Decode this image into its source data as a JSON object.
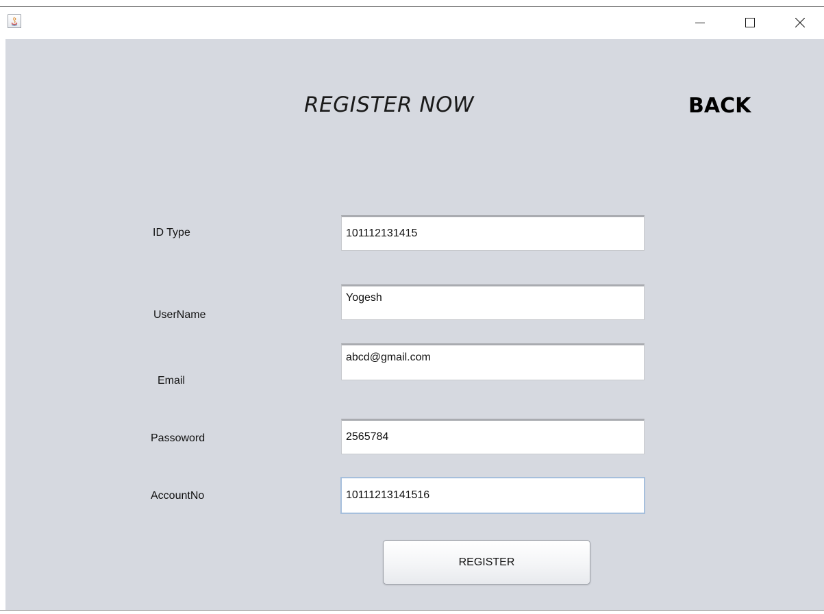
{
  "window": {
    "icon": "java-app-icon",
    "controls": {
      "minimize": "minimize-icon",
      "maximize": "maximize-icon",
      "close": "close-icon"
    }
  },
  "header": {
    "title": "REGISTER NOW",
    "back_label": "BACK"
  },
  "form": {
    "id_type": {
      "label": "ID Type",
      "value": "101112131415"
    },
    "username": {
      "label": "UserName",
      "value": "Yogesh"
    },
    "email": {
      "label": "Email",
      "value": "abcd@gmail.com"
    },
    "password": {
      "label": "Passoword",
      "value": "2565784"
    },
    "account_no": {
      "label": "AccountNo",
      "value": "10111213141516"
    }
  },
  "register_button": {
    "label": "REGISTER"
  },
  "colors": {
    "background": "#d6d9e0",
    "focus_border": "#a6bfdc"
  }
}
